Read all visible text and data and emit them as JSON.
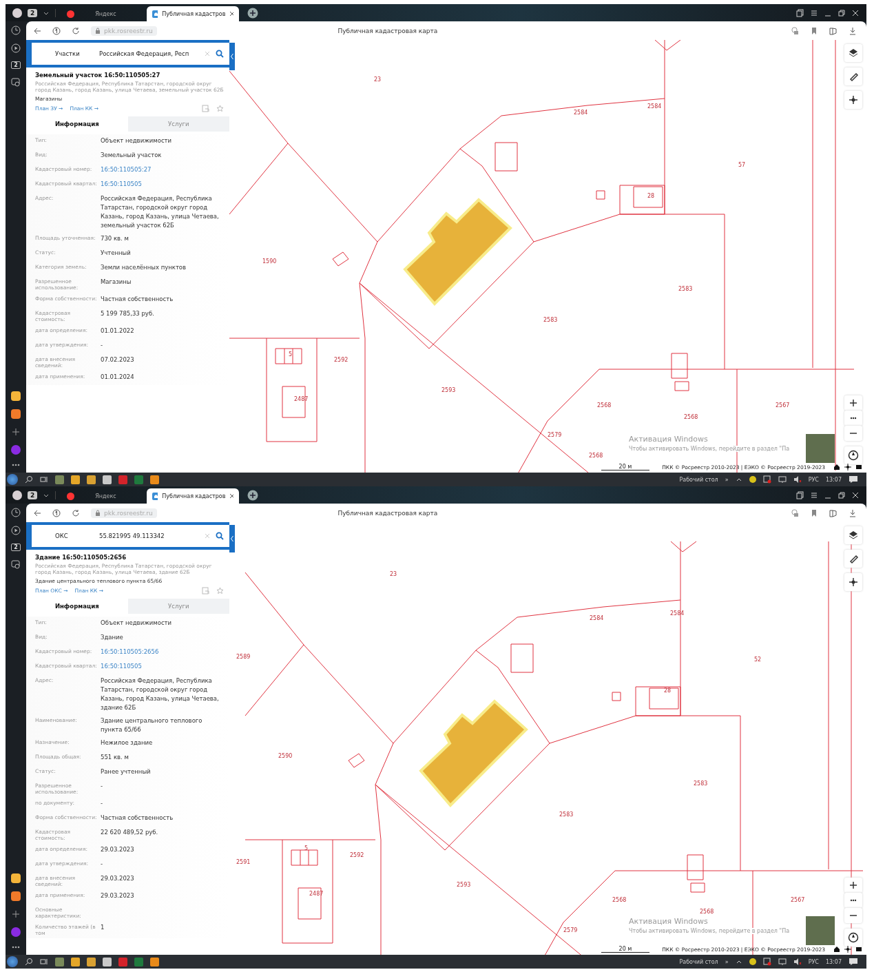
{
  "screens": [
    {
      "browser": {
        "tab_count": "2",
        "tabs": [
          {
            "label": "Яндекс",
            "selected": false
          },
          {
            "label": "Публичная кадастров",
            "selected": true
          }
        ],
        "url": "pkk.rosreestr.ru",
        "page_title": "Публичная кадастровая карта",
        "rail_badge": "2"
      },
      "search": {
        "type": "Участки",
        "query": "Российская Федерация, Респ"
      },
      "object": {
        "title": "Земельный участок 16:50:110505:27",
        "address": "Российская Федерация, Республика Татарстан, городской округ город Казань, город Казань, улица Четаева, земельный участок 62Б",
        "subtitle": "Магазины",
        "links": [
          "План ЗУ →",
          "План КК →"
        ]
      },
      "panel_tabs": [
        {
          "label": "Информация",
          "selected": true
        },
        {
          "label": "Услуги",
          "selected": false
        }
      ],
      "fields": [
        {
          "label": "Тип:",
          "value": "Объект недвижимости",
          "kind": "text"
        },
        {
          "label": "Вид:",
          "value": "Земельный участок",
          "kind": "text"
        },
        {
          "label": "Кадастровый номер:",
          "value": "16:50:110505:27",
          "kind": "link"
        },
        {
          "label": "Кадастровый квартал:",
          "value": "16:50:110505",
          "kind": "link"
        },
        {
          "label": "Адрес:",
          "value": "Российская Федерация, Республика Татарстан, городской округ город Казань, город Казань, улица Четаева, земельный участок 62Б",
          "kind": "text"
        },
        {
          "label": "Площадь уточненная:",
          "value": "730 кв. м",
          "kind": "text"
        },
        {
          "label": "Статус:",
          "value": "Учтенный",
          "kind": "text"
        },
        {
          "label": "Категория земель:",
          "value": "Земли населённых пунктов",
          "kind": "text"
        },
        {
          "label": "Разрешенное использование:",
          "value": "Магазины",
          "kind": "text"
        },
        {
          "label": "Форма собственности:",
          "value": "Частная собственность",
          "kind": "text"
        },
        {
          "label": "Кадастровая стоимость:",
          "value": "5 199 785,33 руб.",
          "kind": "text"
        },
        {
          "label": "дата определения:",
          "value": "01.01.2022",
          "kind": "text"
        },
        {
          "label": "дата утверждения:",
          "value": "-",
          "kind": "text"
        },
        {
          "label": "дата внесения сведений:",
          "value": "07.02.2023",
          "kind": "text"
        },
        {
          "label": "дата применения:",
          "value": "01.01.2024",
          "kind": "text"
        }
      ],
      "map": {
        "labels": [
          "23",
          "2584",
          "2584",
          "57",
          "28",
          "1590",
          "2583",
          "2583",
          "2592",
          "5",
          "2487",
          "2593",
          "2568",
          "2568",
          "2567",
          "2579",
          "2568"
        ],
        "scale": "20 м",
        "attribution": "ПКК © Росреестр 2010-2023 | ЕЭКО © Росреестр 2019-2023",
        "watermark": [
          "Активация Windows",
          "Чтобы активировать Windows, перейдите в раздел \"Па"
        ]
      },
      "taskbar": {
        "desktop": "Рабочий стол",
        "more": "»",
        "language": "РУС",
        "time": "13:07"
      }
    },
    {
      "browser": {
        "tab_count": "2",
        "tabs": [
          {
            "label": "Яндекс",
            "selected": false
          },
          {
            "label": "Публичная кадастров",
            "selected": true
          }
        ],
        "url": "pkk.rosreestr.ru",
        "page_title": "Публичная кадастровая карта",
        "rail_badge": "2"
      },
      "search": {
        "type": "ОКС",
        "query": "55.821995 49.113342"
      },
      "object": {
        "title": "Здание 16:50:110505:2656",
        "address": "Российская Федерация, Республика Татарстан, городской округ город Казань, город Казань, улица Четаева, здание 62Б",
        "subtitle": "Здание центрального теплового пункта 65/66",
        "links": [
          "План ОКС →",
          "План КК →"
        ]
      },
      "panel_tabs": [
        {
          "label": "Информация",
          "selected": true
        },
        {
          "label": "Услуги",
          "selected": false
        }
      ],
      "fields": [
        {
          "label": "Тип:",
          "value": "Объект недвижимости",
          "kind": "text"
        },
        {
          "label": "Вид:",
          "value": "Здание",
          "kind": "text"
        },
        {
          "label": "Кадастровый номер:",
          "value": "16:50:110505:2656",
          "kind": "link"
        },
        {
          "label": "Кадастровый квартал:",
          "value": "16:50:110505",
          "kind": "link"
        },
        {
          "label": "Адрес:",
          "value": "Российская Федерация, Республика Татарстан, городской округ город Казань, город Казань, улица Четаева, здание 62Б",
          "kind": "text"
        },
        {
          "label": "Наименование:",
          "value": "Здание центрального теплового пункта 65/66",
          "kind": "text"
        },
        {
          "label": "Назначение:",
          "value": "Нежилое здание",
          "kind": "text"
        },
        {
          "label": "Площадь общая:",
          "value": "551 кв. м",
          "kind": "text"
        },
        {
          "label": "Статус:",
          "value": "Ранее учтенный",
          "kind": "text"
        },
        {
          "label": "Разрешенное использование:",
          "value": "-",
          "kind": "text"
        },
        {
          "label": "по документу:",
          "value": "-",
          "kind": "text"
        },
        {
          "label": "Форма собственности:",
          "value": "Частная собственность",
          "kind": "text"
        },
        {
          "label": "Кадастровая стоимость:",
          "value": "22 620 489,52 руб.",
          "kind": "text"
        },
        {
          "label": "дата определения:",
          "value": "29.03.2023",
          "kind": "text"
        },
        {
          "label": "дата утверждения:",
          "value": "-",
          "kind": "text"
        },
        {
          "label": "дата внесения сведений:",
          "value": "29.03.2023",
          "kind": "text"
        },
        {
          "label": "дата применения:",
          "value": "29.03.2023",
          "kind": "text"
        },
        {
          "label": "Основные характеристики:",
          "kind": "heading"
        },
        {
          "label": "Количество этажей (в том",
          "value": "1",
          "kind": "text"
        }
      ],
      "map": {
        "labels": [
          "23",
          "2589",
          "2584",
          "2584",
          "52",
          "28",
          "2590",
          "2583",
          "2583",
          "2591",
          "2592",
          "5",
          "2487",
          "2593",
          "2568",
          "2568",
          "2567",
          "2579"
        ],
        "scale": "20 м",
        "attribution": "ПКК © Росреестр 2010-2023 | ЕЭКО © Росреестр 2019-2023",
        "watermark": [
          "Активация Windows",
          "Чтобы активировать Windows, перейдите в раздел \"Па"
        ]
      },
      "taskbar": {
        "desktop": "Рабочий стол",
        "more": "»",
        "language": "РУС",
        "time": "13:07"
      }
    }
  ]
}
